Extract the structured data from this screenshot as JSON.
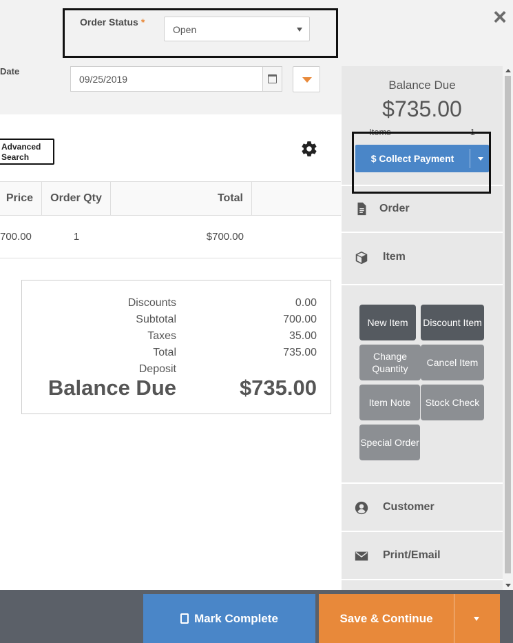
{
  "header": {
    "close_icon": "close-icon",
    "order_status_label": "Order Status",
    "order_status_required": "*",
    "order_status_value": "Open",
    "date_label": "Date",
    "date_value": "09/25/2019"
  },
  "toolbar": {
    "advanced_search_label": "Advanced Search",
    "settings_icon": "gear-icon"
  },
  "table": {
    "columns": [
      "Price",
      "Order Qty",
      "Total"
    ],
    "rows": [
      {
        "price": "700.00",
        "qty": "1",
        "total": "$700.00"
      }
    ]
  },
  "summary": {
    "discounts_label": "Discounts",
    "discounts_value": "0.00",
    "subtotal_label": "Subtotal",
    "subtotal_value": "700.00",
    "taxes_label": "Taxes",
    "taxes_value": "35.00",
    "total_label": "Total",
    "total_value": "735.00",
    "deposit_label": "Deposit",
    "deposit_value": "",
    "balance_label": "Balance Due",
    "balance_value": "$735.00"
  },
  "sidebar": {
    "balance_title": "Balance Due",
    "balance_amount": "$735.00",
    "items_label": "Items",
    "items_count": "1",
    "collect_payment_label": "$ Collect Payment",
    "sections": {
      "order": "Order",
      "item": "Item",
      "customer": "Customer",
      "print_email": "Print/Email"
    },
    "actions": {
      "new_item": "New Item",
      "discount_item": "Discount Item",
      "change_quantity": "Change Quantity",
      "cancel_item": "Cancel Item",
      "item_note": "Item Note",
      "stock_check": "Stock Check",
      "special_order": "Special Order"
    }
  },
  "footer": {
    "mark_complete_label": "Mark Complete",
    "save_continue_label": "Save & Continue"
  },
  "colors": {
    "primary": "#4a86c8",
    "accent": "#e8893a",
    "dark_button": "#555a60",
    "grey_button": "#8c8f93",
    "footer_bg": "#5b6068"
  }
}
